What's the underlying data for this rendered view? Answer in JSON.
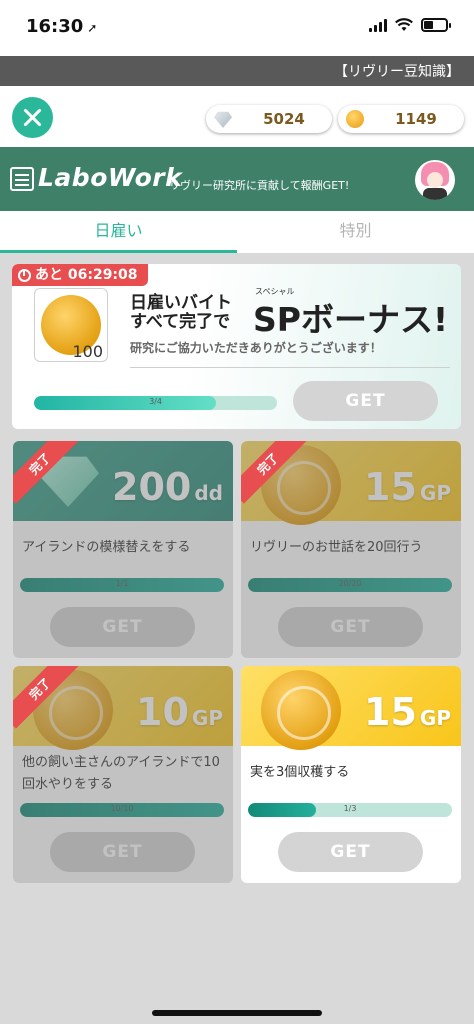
{
  "status": {
    "time": "16:30"
  },
  "ticker": {
    "text": "【リヴリー豆知識】"
  },
  "currency": {
    "diamonds": "5024",
    "coins": "1149"
  },
  "header": {
    "logo": "LaboWork",
    "subtitle": "リヴリー研究所に貢献して報酬GET!"
  },
  "tabs": [
    {
      "label": "日雇い",
      "active": true
    },
    {
      "label": "特別",
      "active": false
    }
  ],
  "bonus": {
    "timer": "あと 06:29:08",
    "reward_qty": "100",
    "line1": "日雇いバイト",
    "line2": "すべて完了で",
    "ruby": "スペシャル",
    "big": "SPボーナス!",
    "sub": "研究にご協力いただきありがとうございます！",
    "progress_text": "3/4",
    "progress": 0.75,
    "button": "GET"
  },
  "tasks": [
    {
      "badge": "完了",
      "amount": "200",
      "unit": "dd",
      "title": "アイランドの模様替えをする",
      "progress_text": "1/1",
      "progress": 1.0,
      "button": "GET",
      "completed": true,
      "icon": "diamond-icon"
    },
    {
      "badge": "完了",
      "amount": "15",
      "unit": "GP",
      "title": "リヴリーのお世話を20回行う",
      "progress_text": "20/20",
      "progress": 1.0,
      "button": "GET",
      "completed": true,
      "icon": "coin-icon"
    },
    {
      "badge": "完了",
      "amount": "10",
      "unit": "GP",
      "title": "他の飼い主さんのアイランドで10回水やりをする",
      "progress_text": "10/10",
      "progress": 1.0,
      "button": "GET",
      "completed": true,
      "icon": "coin-icon"
    },
    {
      "badge": "",
      "amount": "15",
      "unit": "GP",
      "title": "実を3個収穫する",
      "progress_text": "1/3",
      "progress": 0.3333,
      "button": "GET",
      "completed": false,
      "icon": "coin-icon"
    }
  ],
  "colors": {
    "accent": "#2bb79a",
    "header": "#3f8069",
    "badge": "#e84d4f"
  }
}
